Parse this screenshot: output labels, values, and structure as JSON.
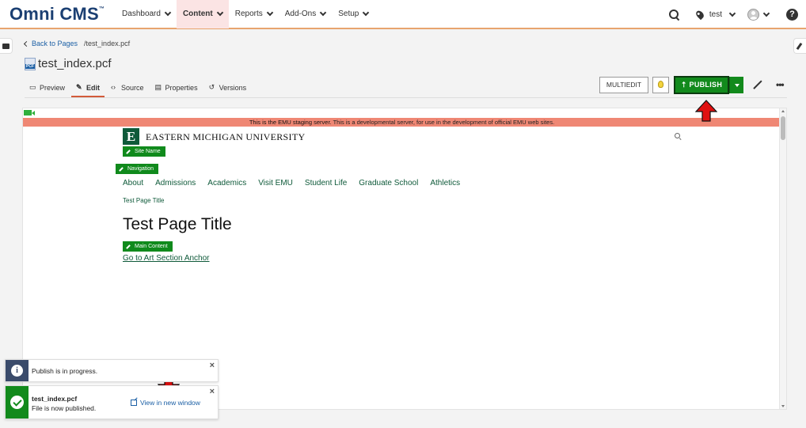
{
  "app": {
    "logo": "Omni CMS",
    "trademark": "™"
  },
  "nav": {
    "items": [
      {
        "label": "Dashboard",
        "active": false
      },
      {
        "label": "Content",
        "active": true
      },
      {
        "label": "Reports",
        "active": false
      },
      {
        "label": "Add-Ons",
        "active": false
      },
      {
        "label": "Setup",
        "active": false
      }
    ],
    "site": "test"
  },
  "breadcrumb": {
    "back": "Back to Pages",
    "path": "/test_index.pcf"
  },
  "page": {
    "title": "test_index.pcf",
    "file_badge": "PCF"
  },
  "tabs": [
    {
      "label": "Preview",
      "icon": "monitor-icon"
    },
    {
      "label": "Edit",
      "icon": "pencil-icon",
      "active": true
    },
    {
      "label": "Source",
      "icon": "code-icon"
    },
    {
      "label": "Properties",
      "icon": "briefcase-icon"
    },
    {
      "label": "Versions",
      "icon": "history-icon"
    }
  ],
  "toolbar": {
    "multiedit": "MULTIEDIT",
    "publish": "PUBLISH"
  },
  "preview": {
    "banner_bold": "This is the EMU staging server.",
    "banner_rest": " This is a developmental server, for use in the development of official EMU web sites.",
    "logo_letter": "E",
    "university": "EASTERN MICHIGAN UNIVERSITY",
    "site_name_badge": "Site Name",
    "navigation_badge": "Navigation",
    "menu": [
      "About",
      "Admissions",
      "Academics",
      "Visit EMU",
      "Student Life",
      "Graduate School",
      "Athletics"
    ],
    "crumb_title": "Test Page Title",
    "heading": "Test Page Title",
    "main_content_badge": "Main Content",
    "anchor_link": "Go to Art Section Anchor"
  },
  "toasts": {
    "progress": "Publish is in progress.",
    "published_file": "test_index.pcf",
    "published_msg": "File is now published.",
    "view_link": "View in new window"
  },
  "colors": {
    "publish_green": "#128a1c",
    "emu_green": "#0f5a3a",
    "banner": "#ef8774",
    "arrow_red": "#e01010"
  }
}
